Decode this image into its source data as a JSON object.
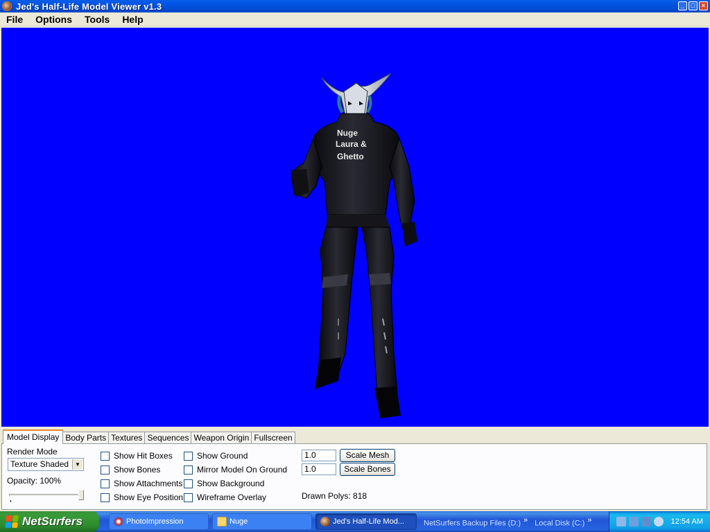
{
  "window": {
    "title": "Jed's Half-Life Model Viewer v1.3",
    "buttons": {
      "minimize": "_",
      "maximize": "□",
      "close": "×"
    }
  },
  "menu": [
    "File",
    "Options",
    "Tools",
    "Help"
  ],
  "viewport": {
    "background": "#0000FF",
    "shirt_text": [
      "Nuge",
      "Laura &",
      "Ghetto"
    ]
  },
  "tabs": [
    "Model Display",
    "Body Parts",
    "Textures",
    "Sequences",
    "Weapon Origin",
    "Fullscreen"
  ],
  "model_display": {
    "render_mode_label": "Render Mode",
    "render_mode_value": "Texture Shaded",
    "opacity_label": "Opacity: 100%",
    "opacity_fraction": 1.0,
    "checks_col1": [
      "Show Hit Boxes",
      "Show Bones",
      "Show Attachments",
      "Show Eye Position"
    ],
    "checks_col2": [
      "Show Ground",
      "Mirror Model On Ground",
      "Show Background",
      "Wireframe Overlay"
    ],
    "scale_mesh_value": "1.0",
    "scale_bones_value": "1.0",
    "scale_mesh_button": "Scale Mesh",
    "scale_bones_button": "Scale Bones",
    "drawn_polys": "Drawn Polys: 818"
  },
  "taskbar": {
    "start_label": "NetSurfers",
    "tasks": [
      "PhotoImpression",
      "Nuge",
      "Jed's Half-Life Mod..."
    ],
    "quick_links": [
      "NetSurfers Backup Files (D:)",
      "Local Disk (C:)"
    ],
    "chevron": "»",
    "clock": "12:54 AM"
  }
}
